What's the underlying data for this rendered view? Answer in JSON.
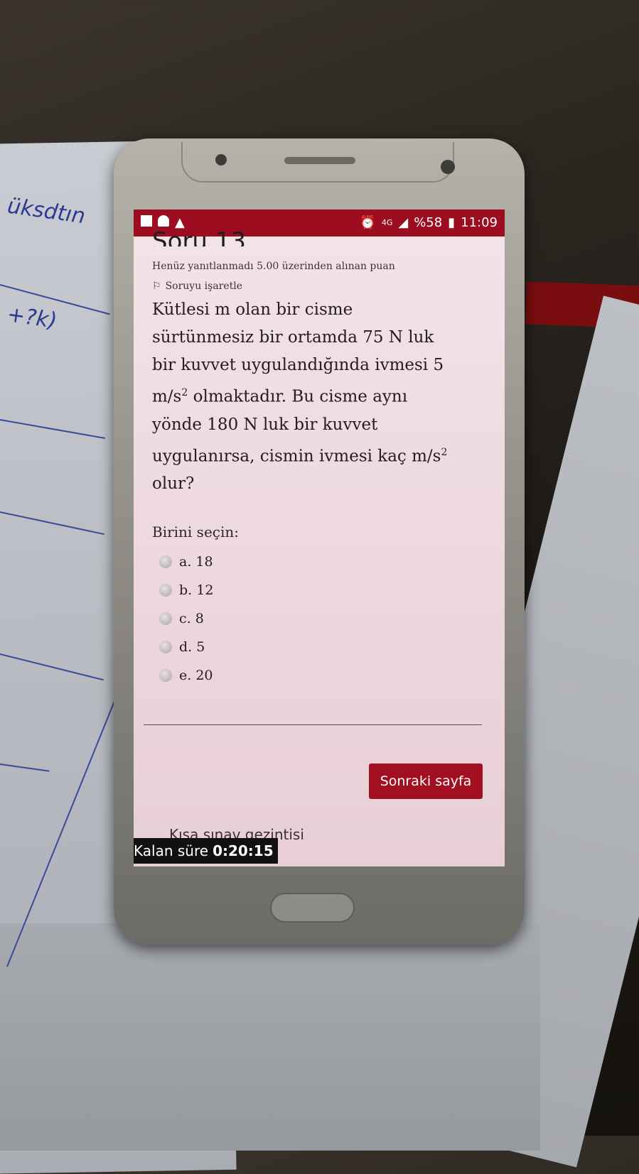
{
  "status_bar": {
    "battery": "%58",
    "time": "11:09",
    "network": "4G"
  },
  "quiz": {
    "question_title": "Soru 13",
    "state": "Henüz yanıtlanmadı  5.00 üzerinden alınan puan",
    "flag_label": "Soruyu işaretle",
    "question_lines": [
      "Kütlesi m olan bir cisme",
      "sürtünmesiz bir ortamda 75 N luk",
      "bir kuvvet uygulandığında ivmesi 5",
      "olmaktadır. Bu cisme aynı",
      "yönde 180 N luk bir kuvvet",
      "uygulanırsa, cismin ivmesi kaç m/s",
      "olur?"
    ],
    "unit": "m/s",
    "superscript": "2",
    "prompt": "Birini seçin:",
    "options": [
      "a. 18",
      "b. 12",
      "c. 8",
      "d. 5",
      "e. 20"
    ],
    "next_button": "Sonraki sayfa",
    "navigation_label": "Kısa sınav gezintisi",
    "timer_label": "Kalan süre",
    "timer_value": "0:20:15"
  },
  "handwriting": {
    "note_top": "üksdtın",
    "note_mid": "+?k)"
  },
  "colors": {
    "brand": "#9b0d1f",
    "button": "#a10f20"
  }
}
